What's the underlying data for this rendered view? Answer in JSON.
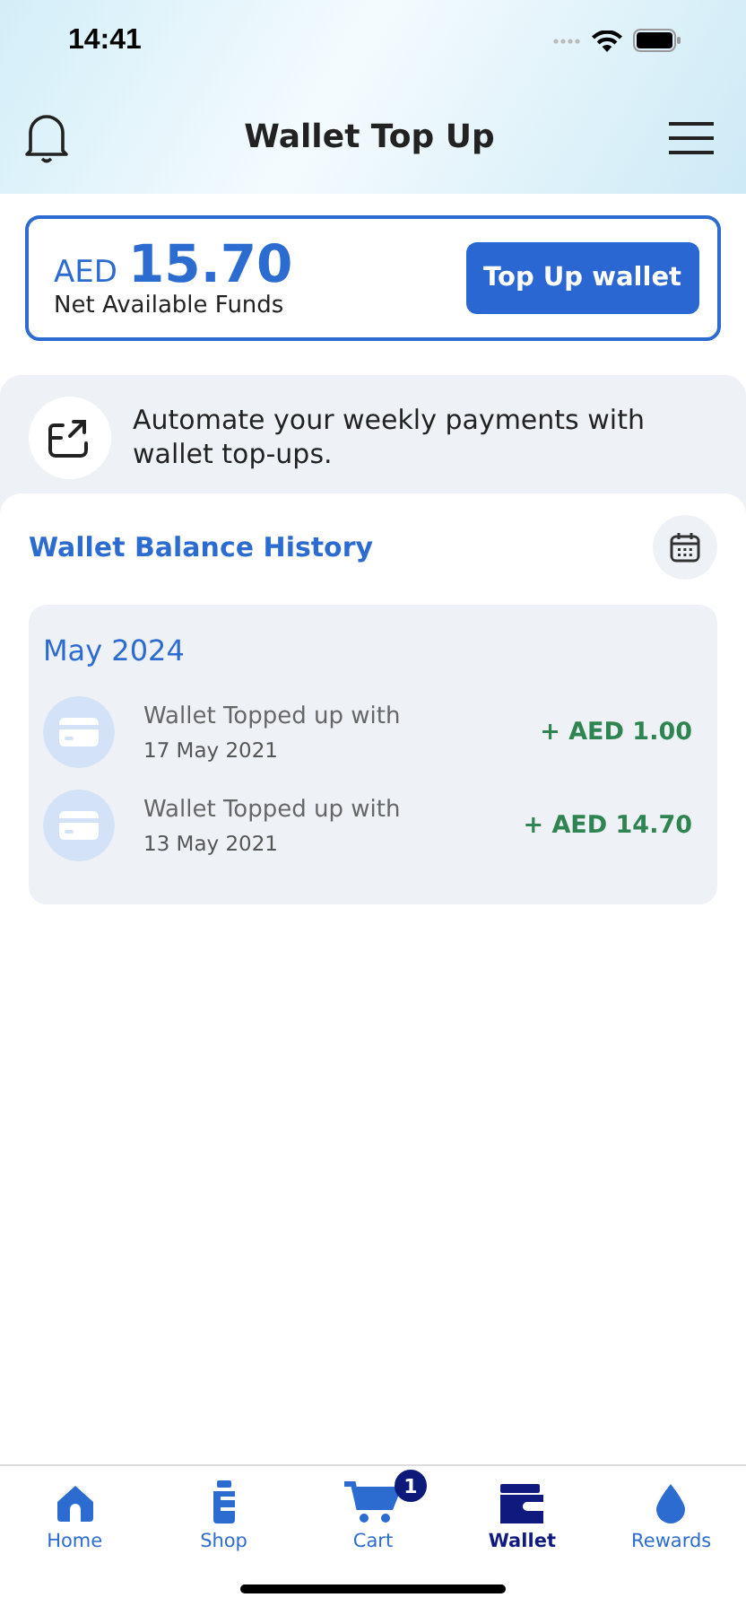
{
  "status_bar": {
    "time": "14:41"
  },
  "header": {
    "title": "Wallet Top Up"
  },
  "balance": {
    "currency": "AED",
    "amount": "15.70",
    "caption": "Net Available Funds",
    "button": "Top Up wallet"
  },
  "promo": {
    "text": "Automate your weekly payments with wallet top-ups."
  },
  "history": {
    "title": "Wallet Balance History",
    "groups": [
      {
        "month": "May 2024",
        "items": [
          {
            "label": "Wallet Topped up with",
            "date": "17 May 2021",
            "amount": "+ AED 1.00"
          },
          {
            "label": "Wallet Topped up with",
            "date": "13 May 2021",
            "amount": "+ AED 14.70"
          }
        ]
      }
    ]
  },
  "tabs": [
    {
      "kind": "home",
      "label": "Home",
      "selected": false
    },
    {
      "kind": "shop",
      "label": "Shop",
      "selected": false
    },
    {
      "kind": "cart",
      "label": "Cart",
      "selected": false,
      "badge": "1"
    },
    {
      "kind": "wallet",
      "label": "Wallet",
      "selected": true
    },
    {
      "kind": "rewards",
      "label": "Rewards",
      "selected": false
    }
  ]
}
